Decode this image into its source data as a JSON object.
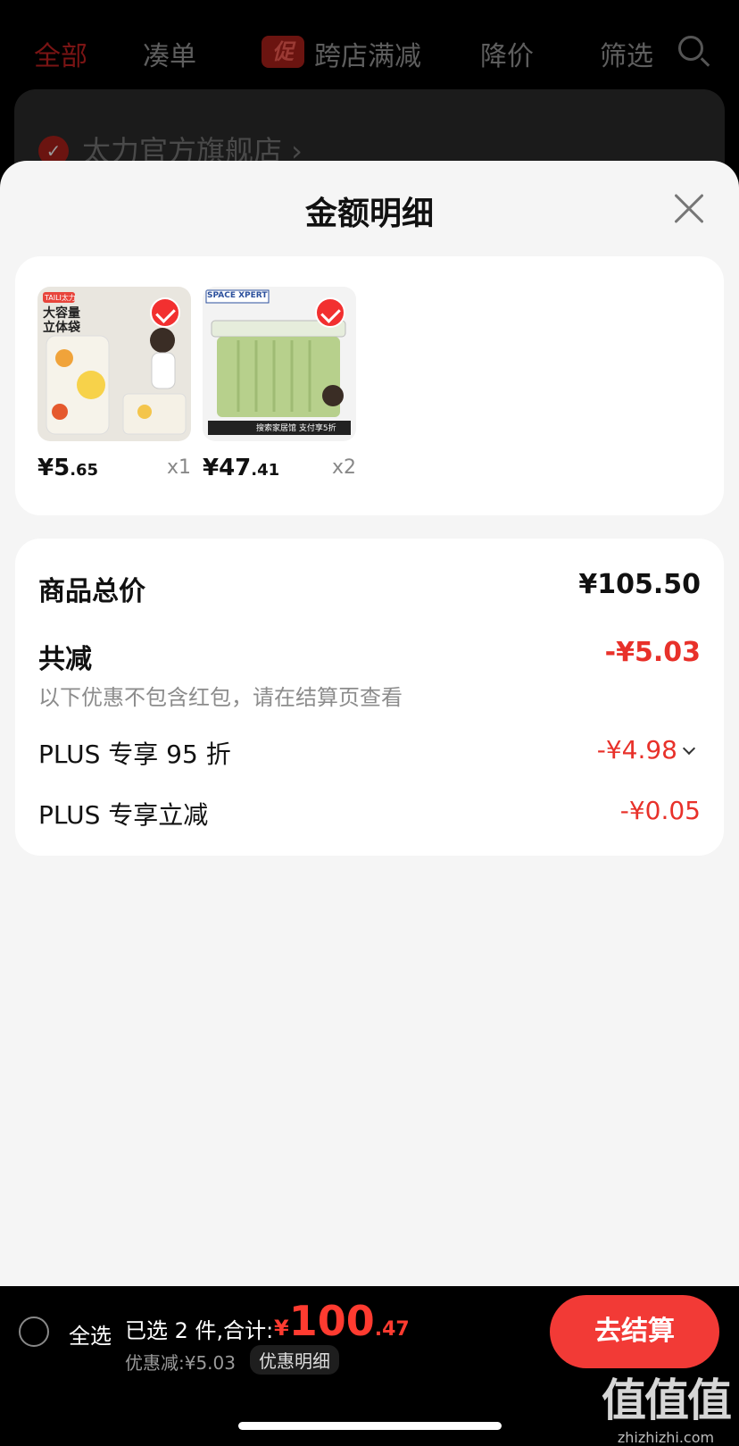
{
  "top_nav": {
    "tabs": [
      "全部",
      "凑单",
      "跨店满减",
      "降价",
      "筛选"
    ],
    "promo_badge": "促"
  },
  "store": {
    "name": "太力官方旗舰店 ›"
  },
  "sheet": {
    "title": "金额明细",
    "products": [
      {
        "image_title": "大容量\n立体袋",
        "brand_tag": "TAILI太力",
        "price_int": "¥5",
        "price_dec": ".65",
        "qty": "x1"
      },
      {
        "brand_tag": "SPACE XPERT",
        "banner": "搜索家居馆 支付享5折",
        "price_int": "¥47",
        "price_dec": ".41",
        "qty": "x2"
      }
    ],
    "summary": {
      "total_label": "商品总价",
      "total_value": "¥105.50",
      "discount_label": "共减",
      "discount_value": "-¥5.03",
      "note": "以下优惠不包含红包，请在结算页查看",
      "items": [
        {
          "label": "PLUS 专享 95 折",
          "value": "-¥4.98"
        },
        {
          "label": "PLUS 专享立减",
          "value": "-¥0.05"
        }
      ]
    }
  },
  "bottom": {
    "select_all": "全选",
    "selected": "已选 2 件,合计:",
    "total_sym": "¥",
    "total_int": "100",
    "total_dec": ".47",
    "saving": "优惠减:¥5.03",
    "detail_tag": "优惠明细",
    "checkout": "去结算"
  },
  "watermark": {
    "logo": "值值值",
    "url": "zhizhizhi.com"
  },
  "colors": {
    "accent": "#f23a36",
    "discount_red": "#e8312a"
  }
}
